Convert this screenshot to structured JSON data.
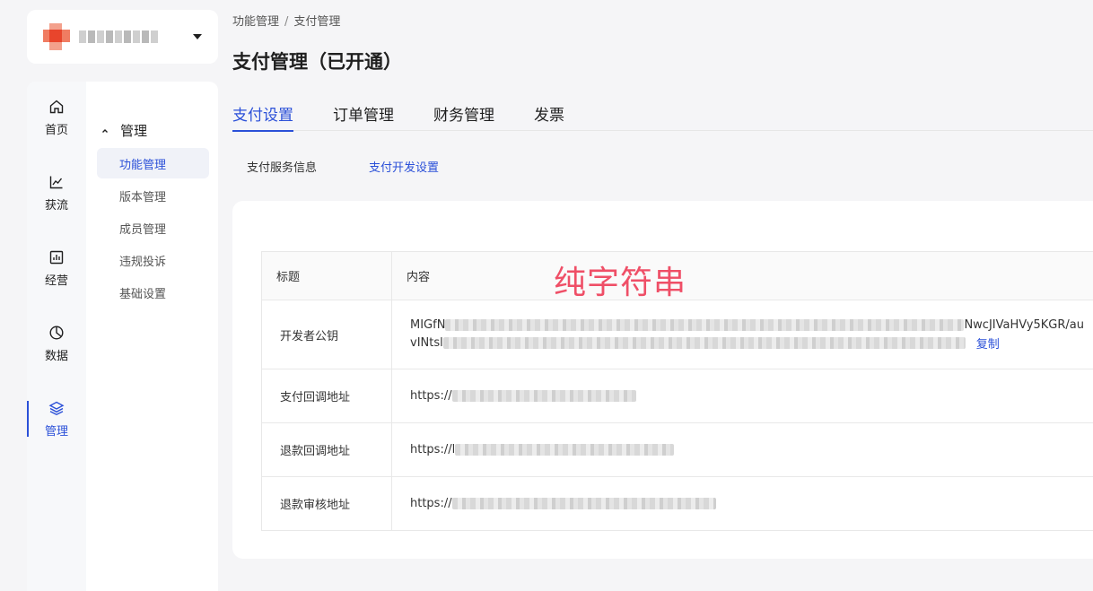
{
  "breadcrumb": {
    "parent": "功能管理",
    "current": "支付管理"
  },
  "page_title": "支付管理（已开通）",
  "rail": [
    {
      "label": "首页",
      "icon": "home-icon"
    },
    {
      "label": "获流",
      "icon": "trend-chart-icon"
    },
    {
      "label": "经营",
      "icon": "bar-chart-icon"
    },
    {
      "label": "数据",
      "icon": "pie-chart-icon"
    },
    {
      "label": "管理",
      "icon": "layers-icon",
      "active": true
    }
  ],
  "menu": {
    "group_label": "管理",
    "items": [
      "功能管理",
      "版本管理",
      "成员管理",
      "违规投诉",
      "基础设置"
    ],
    "active_index": 0
  },
  "tabs": [
    "支付设置",
    "订单管理",
    "财务管理",
    "发票"
  ],
  "subtabs": [
    "支付服务信息",
    "支付开发设置"
  ],
  "table": {
    "header": {
      "title": "标题",
      "content": "内容"
    },
    "rows": [
      {
        "label": "开发者公钥",
        "line1_prefix": "MIGfN",
        "line1_suffix": "NwcJIVaHVy5KGR/au",
        "line2_prefix": "vINtsl",
        "copy_label": "复制"
      },
      {
        "label": "支付回调地址",
        "value_prefix": "https://"
      },
      {
        "label": "退款回调地址",
        "value_prefix": "https://l"
      },
      {
        "label": "退款审核地址",
        "value_prefix": "https://"
      }
    ]
  },
  "annotation": "纯字符串",
  "colors": {
    "accent": "#2b50d8",
    "annotation": "#ef4f67"
  }
}
